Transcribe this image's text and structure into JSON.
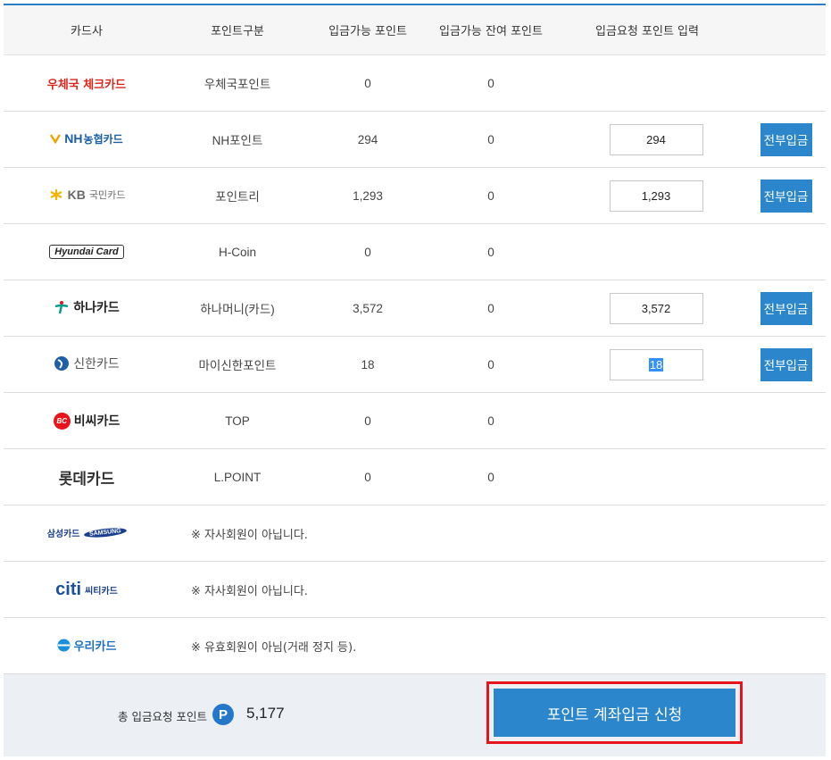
{
  "header": {
    "card": "카드사",
    "type": "포인트구분",
    "available": "입금가능 포인트",
    "remaining": "입금가능 잔여 포인트",
    "request": "입금요청 포인트 입력"
  },
  "rows": [
    {
      "logo": "우체국 체크카드",
      "type": "우체국포인트",
      "available": "0",
      "remaining": "0"
    },
    {
      "logo_mark": "NH",
      "logo": "농협카드",
      "type": "NH포인트",
      "available": "294",
      "remaining": "0",
      "input": "294",
      "button": "전부입금"
    },
    {
      "logo_mark": "KB",
      "logo": "국민카드",
      "type": "포인트리",
      "available": "1,293",
      "remaining": "0",
      "input": "1,293",
      "button": "전부입금"
    },
    {
      "logo": "Hyundai Card",
      "type": "H-Coin",
      "available": "0",
      "remaining": "0"
    },
    {
      "logo": "하나카드",
      "type": "하나머니(카드)",
      "available": "3,572",
      "remaining": "0",
      "input": "3,572",
      "button": "전부입금"
    },
    {
      "logo": "신한카드",
      "type": "마이신한포인트",
      "available": "18",
      "remaining": "0",
      "input": "18",
      "button": "전부입금"
    },
    {
      "logo_mark": "BC",
      "logo": "비씨카드",
      "type": "TOP",
      "available": "0",
      "remaining": "0"
    },
    {
      "logo": "롯데카드",
      "type": "L.POINT",
      "available": "0",
      "remaining": "0"
    },
    {
      "logo": "삼성카드",
      "logo_mark": "SAMSUNG",
      "note": "※ 자사회원이 아닙니다."
    },
    {
      "logo_mark": "citi",
      "logo": "씨티카드",
      "note": "※ 자사회원이 아닙니다."
    },
    {
      "logo": "우리카드",
      "note": "※ 유효회원이 아님(거래 정지 등)."
    }
  ],
  "summary": {
    "label": "총 입금요청 포인트",
    "badge": "P",
    "total": "5,177",
    "apply_button": "포인트 계좌입금 신청"
  },
  "colors": {
    "accent": "#2b86cb",
    "highlight_border": "#e8141b",
    "summary_bg": "#eceff4",
    "header_bg": "#f6f6f6"
  }
}
